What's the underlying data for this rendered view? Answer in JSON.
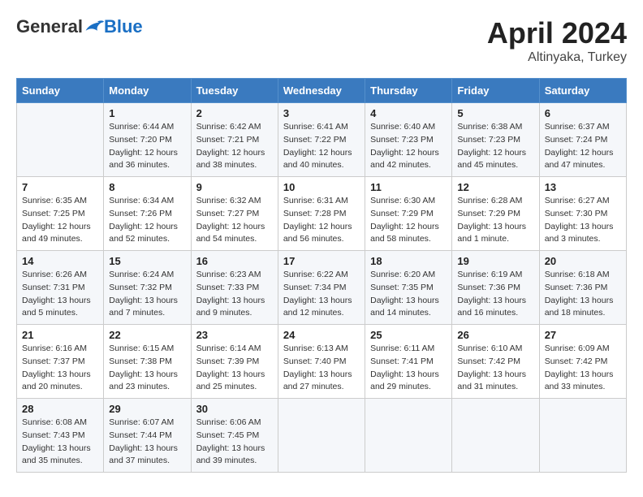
{
  "header": {
    "logo_general": "General",
    "logo_blue": "Blue",
    "month_year": "April 2024",
    "location": "Altinyaka, Turkey"
  },
  "days_of_week": [
    "Sunday",
    "Monday",
    "Tuesday",
    "Wednesday",
    "Thursday",
    "Friday",
    "Saturday"
  ],
  "weeks": [
    [
      {
        "day": "",
        "sunrise": "",
        "sunset": "",
        "daylight": ""
      },
      {
        "day": "1",
        "sunrise": "Sunrise: 6:44 AM",
        "sunset": "Sunset: 7:20 PM",
        "daylight": "Daylight: 12 hours and 36 minutes."
      },
      {
        "day": "2",
        "sunrise": "Sunrise: 6:42 AM",
        "sunset": "Sunset: 7:21 PM",
        "daylight": "Daylight: 12 hours and 38 minutes."
      },
      {
        "day": "3",
        "sunrise": "Sunrise: 6:41 AM",
        "sunset": "Sunset: 7:22 PM",
        "daylight": "Daylight: 12 hours and 40 minutes."
      },
      {
        "day": "4",
        "sunrise": "Sunrise: 6:40 AM",
        "sunset": "Sunset: 7:23 PM",
        "daylight": "Daylight: 12 hours and 42 minutes."
      },
      {
        "day": "5",
        "sunrise": "Sunrise: 6:38 AM",
        "sunset": "Sunset: 7:23 PM",
        "daylight": "Daylight: 12 hours and 45 minutes."
      },
      {
        "day": "6",
        "sunrise": "Sunrise: 6:37 AM",
        "sunset": "Sunset: 7:24 PM",
        "daylight": "Daylight: 12 hours and 47 minutes."
      }
    ],
    [
      {
        "day": "7",
        "sunrise": "Sunrise: 6:35 AM",
        "sunset": "Sunset: 7:25 PM",
        "daylight": "Daylight: 12 hours and 49 minutes."
      },
      {
        "day": "8",
        "sunrise": "Sunrise: 6:34 AM",
        "sunset": "Sunset: 7:26 PM",
        "daylight": "Daylight: 12 hours and 52 minutes."
      },
      {
        "day": "9",
        "sunrise": "Sunrise: 6:32 AM",
        "sunset": "Sunset: 7:27 PM",
        "daylight": "Daylight: 12 hours and 54 minutes."
      },
      {
        "day": "10",
        "sunrise": "Sunrise: 6:31 AM",
        "sunset": "Sunset: 7:28 PM",
        "daylight": "Daylight: 12 hours and 56 minutes."
      },
      {
        "day": "11",
        "sunrise": "Sunrise: 6:30 AM",
        "sunset": "Sunset: 7:29 PM",
        "daylight": "Daylight: 12 hours and 58 minutes."
      },
      {
        "day": "12",
        "sunrise": "Sunrise: 6:28 AM",
        "sunset": "Sunset: 7:29 PM",
        "daylight": "Daylight: 13 hours and 1 minute."
      },
      {
        "day": "13",
        "sunrise": "Sunrise: 6:27 AM",
        "sunset": "Sunset: 7:30 PM",
        "daylight": "Daylight: 13 hours and 3 minutes."
      }
    ],
    [
      {
        "day": "14",
        "sunrise": "Sunrise: 6:26 AM",
        "sunset": "Sunset: 7:31 PM",
        "daylight": "Daylight: 13 hours and 5 minutes."
      },
      {
        "day": "15",
        "sunrise": "Sunrise: 6:24 AM",
        "sunset": "Sunset: 7:32 PM",
        "daylight": "Daylight: 13 hours and 7 minutes."
      },
      {
        "day": "16",
        "sunrise": "Sunrise: 6:23 AM",
        "sunset": "Sunset: 7:33 PM",
        "daylight": "Daylight: 13 hours and 9 minutes."
      },
      {
        "day": "17",
        "sunrise": "Sunrise: 6:22 AM",
        "sunset": "Sunset: 7:34 PM",
        "daylight": "Daylight: 13 hours and 12 minutes."
      },
      {
        "day": "18",
        "sunrise": "Sunrise: 6:20 AM",
        "sunset": "Sunset: 7:35 PM",
        "daylight": "Daylight: 13 hours and 14 minutes."
      },
      {
        "day": "19",
        "sunrise": "Sunrise: 6:19 AM",
        "sunset": "Sunset: 7:36 PM",
        "daylight": "Daylight: 13 hours and 16 minutes."
      },
      {
        "day": "20",
        "sunrise": "Sunrise: 6:18 AM",
        "sunset": "Sunset: 7:36 PM",
        "daylight": "Daylight: 13 hours and 18 minutes."
      }
    ],
    [
      {
        "day": "21",
        "sunrise": "Sunrise: 6:16 AM",
        "sunset": "Sunset: 7:37 PM",
        "daylight": "Daylight: 13 hours and 20 minutes."
      },
      {
        "day": "22",
        "sunrise": "Sunrise: 6:15 AM",
        "sunset": "Sunset: 7:38 PM",
        "daylight": "Daylight: 13 hours and 23 minutes."
      },
      {
        "day": "23",
        "sunrise": "Sunrise: 6:14 AM",
        "sunset": "Sunset: 7:39 PM",
        "daylight": "Daylight: 13 hours and 25 minutes."
      },
      {
        "day": "24",
        "sunrise": "Sunrise: 6:13 AM",
        "sunset": "Sunset: 7:40 PM",
        "daylight": "Daylight: 13 hours and 27 minutes."
      },
      {
        "day": "25",
        "sunrise": "Sunrise: 6:11 AM",
        "sunset": "Sunset: 7:41 PM",
        "daylight": "Daylight: 13 hours and 29 minutes."
      },
      {
        "day": "26",
        "sunrise": "Sunrise: 6:10 AM",
        "sunset": "Sunset: 7:42 PM",
        "daylight": "Daylight: 13 hours and 31 minutes."
      },
      {
        "day": "27",
        "sunrise": "Sunrise: 6:09 AM",
        "sunset": "Sunset: 7:42 PM",
        "daylight": "Daylight: 13 hours and 33 minutes."
      }
    ],
    [
      {
        "day": "28",
        "sunrise": "Sunrise: 6:08 AM",
        "sunset": "Sunset: 7:43 PM",
        "daylight": "Daylight: 13 hours and 35 minutes."
      },
      {
        "day": "29",
        "sunrise": "Sunrise: 6:07 AM",
        "sunset": "Sunset: 7:44 PM",
        "daylight": "Daylight: 13 hours and 37 minutes."
      },
      {
        "day": "30",
        "sunrise": "Sunrise: 6:06 AM",
        "sunset": "Sunset: 7:45 PM",
        "daylight": "Daylight: 13 hours and 39 minutes."
      },
      {
        "day": "",
        "sunrise": "",
        "sunset": "",
        "daylight": ""
      },
      {
        "day": "",
        "sunrise": "",
        "sunset": "",
        "daylight": ""
      },
      {
        "day": "",
        "sunrise": "",
        "sunset": "",
        "daylight": ""
      },
      {
        "day": "",
        "sunrise": "",
        "sunset": "",
        "daylight": ""
      }
    ]
  ]
}
